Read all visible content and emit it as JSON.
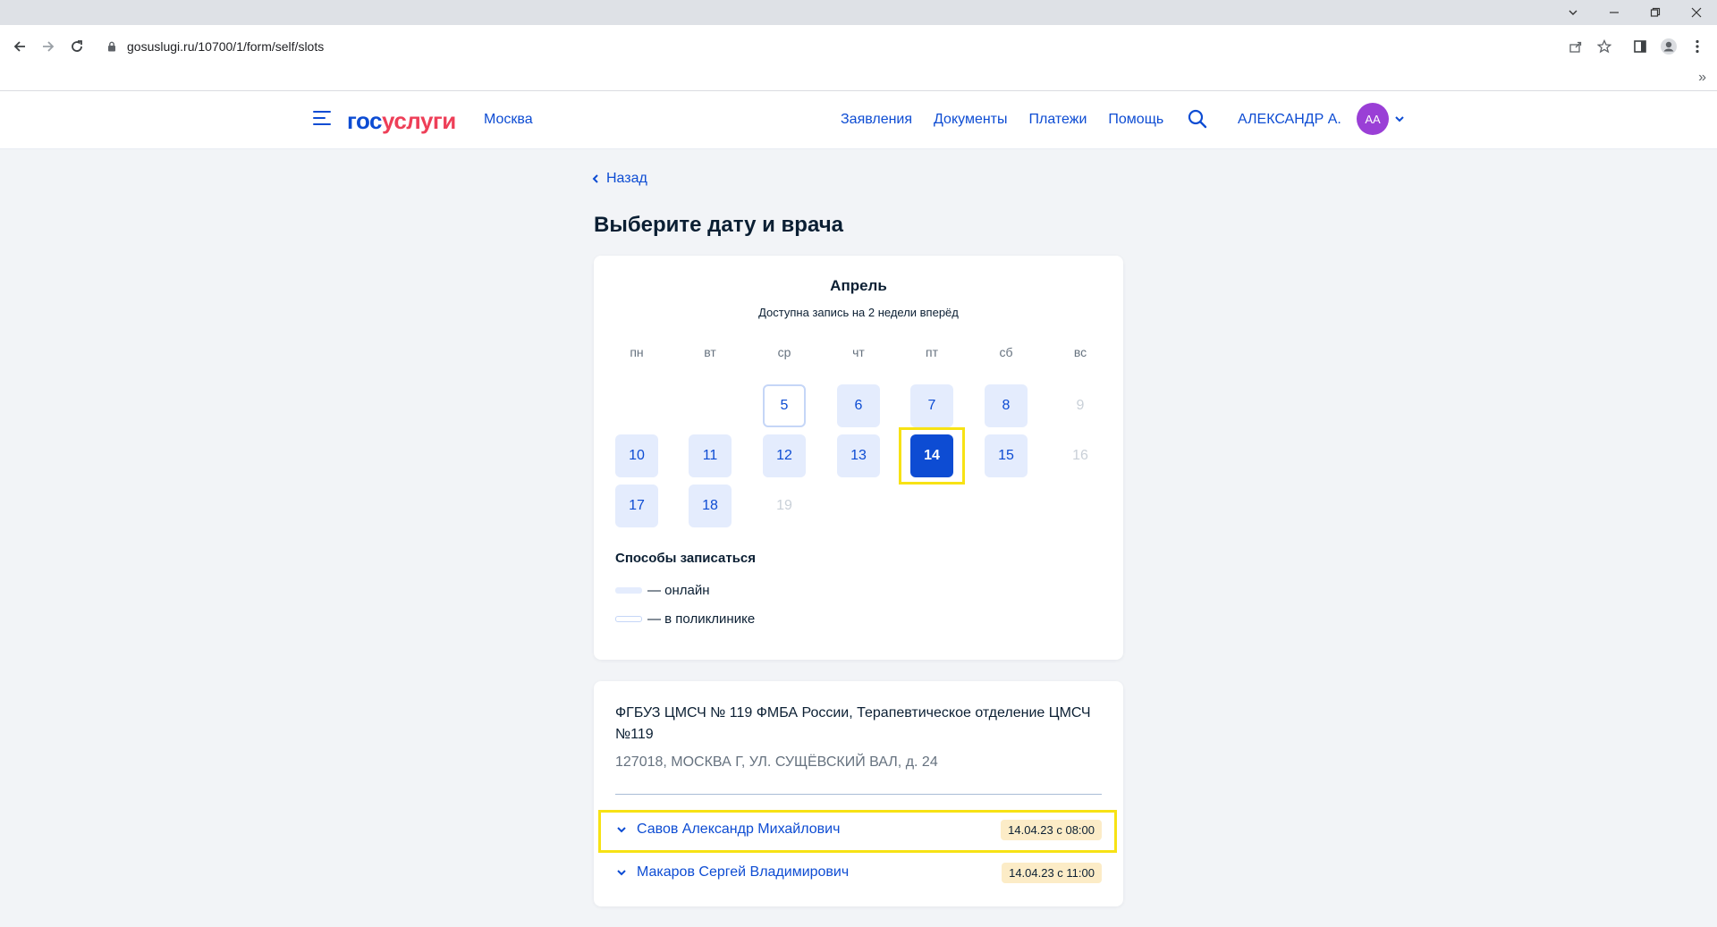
{
  "browser": {
    "url": "gosuslugi.ru/10700/1/form/self/slots",
    "more_bookmarks": "»"
  },
  "header": {
    "logo_part1": "гос",
    "logo_part2": "услуги",
    "city": "Москва",
    "nav": [
      "Заявления",
      "Документы",
      "Платежи",
      "Помощь"
    ],
    "user_name": "АЛЕКСАНДР А.",
    "avatar_initials": "АА"
  },
  "page": {
    "back_label": "Назад",
    "title": "Выберите дату и врача"
  },
  "calendar": {
    "month": "Апрель",
    "note": "Доступна запись на 2 недели вперёд",
    "weekdays": [
      "пн",
      "вт",
      "ср",
      "чт",
      "пт",
      "сб",
      "вс"
    ],
    "days": [
      {
        "label": "5",
        "kind": "clinic"
      },
      {
        "label": "6",
        "kind": "online"
      },
      {
        "label": "7",
        "kind": "online"
      },
      {
        "label": "8",
        "kind": "online"
      },
      {
        "label": "9",
        "kind": "disabled"
      },
      {
        "label": "10",
        "kind": "online"
      },
      {
        "label": "11",
        "kind": "online"
      },
      {
        "label": "12",
        "kind": "online"
      },
      {
        "label": "13",
        "kind": "online"
      },
      {
        "label": "14",
        "kind": "selected"
      },
      {
        "label": "15",
        "kind": "online"
      },
      {
        "label": "16",
        "kind": "disabled"
      },
      {
        "label": "17",
        "kind": "online"
      },
      {
        "label": "18",
        "kind": "online"
      },
      {
        "label": "19",
        "kind": "disabled"
      }
    ],
    "selected_day": "14"
  },
  "legend": {
    "title": "Способы записаться",
    "online": "— онлайн",
    "clinic": "— в поликлинике"
  },
  "clinic": {
    "name": "ФГБУЗ ЦМСЧ № 119 ФМБА России, Терапевтическое отделение ЦМСЧ №119",
    "address": "127018, МОСКВА Г, УЛ. СУЩЁВСКИЙ ВАЛ, д. 24",
    "doctors": [
      {
        "name": "Савов Александр Михайлович",
        "slot": "14.04.23 с 08:00"
      },
      {
        "name": "Макаров Сергей Владимирович",
        "slot": "14.04.23 с 11:00"
      }
    ]
  },
  "colors": {
    "accent": "#0d4cd3",
    "brand_red": "#ee3f58",
    "highlight": "#f7e214",
    "online_day": "#e4ecfd",
    "slot_badge": "#fcecc7"
  }
}
